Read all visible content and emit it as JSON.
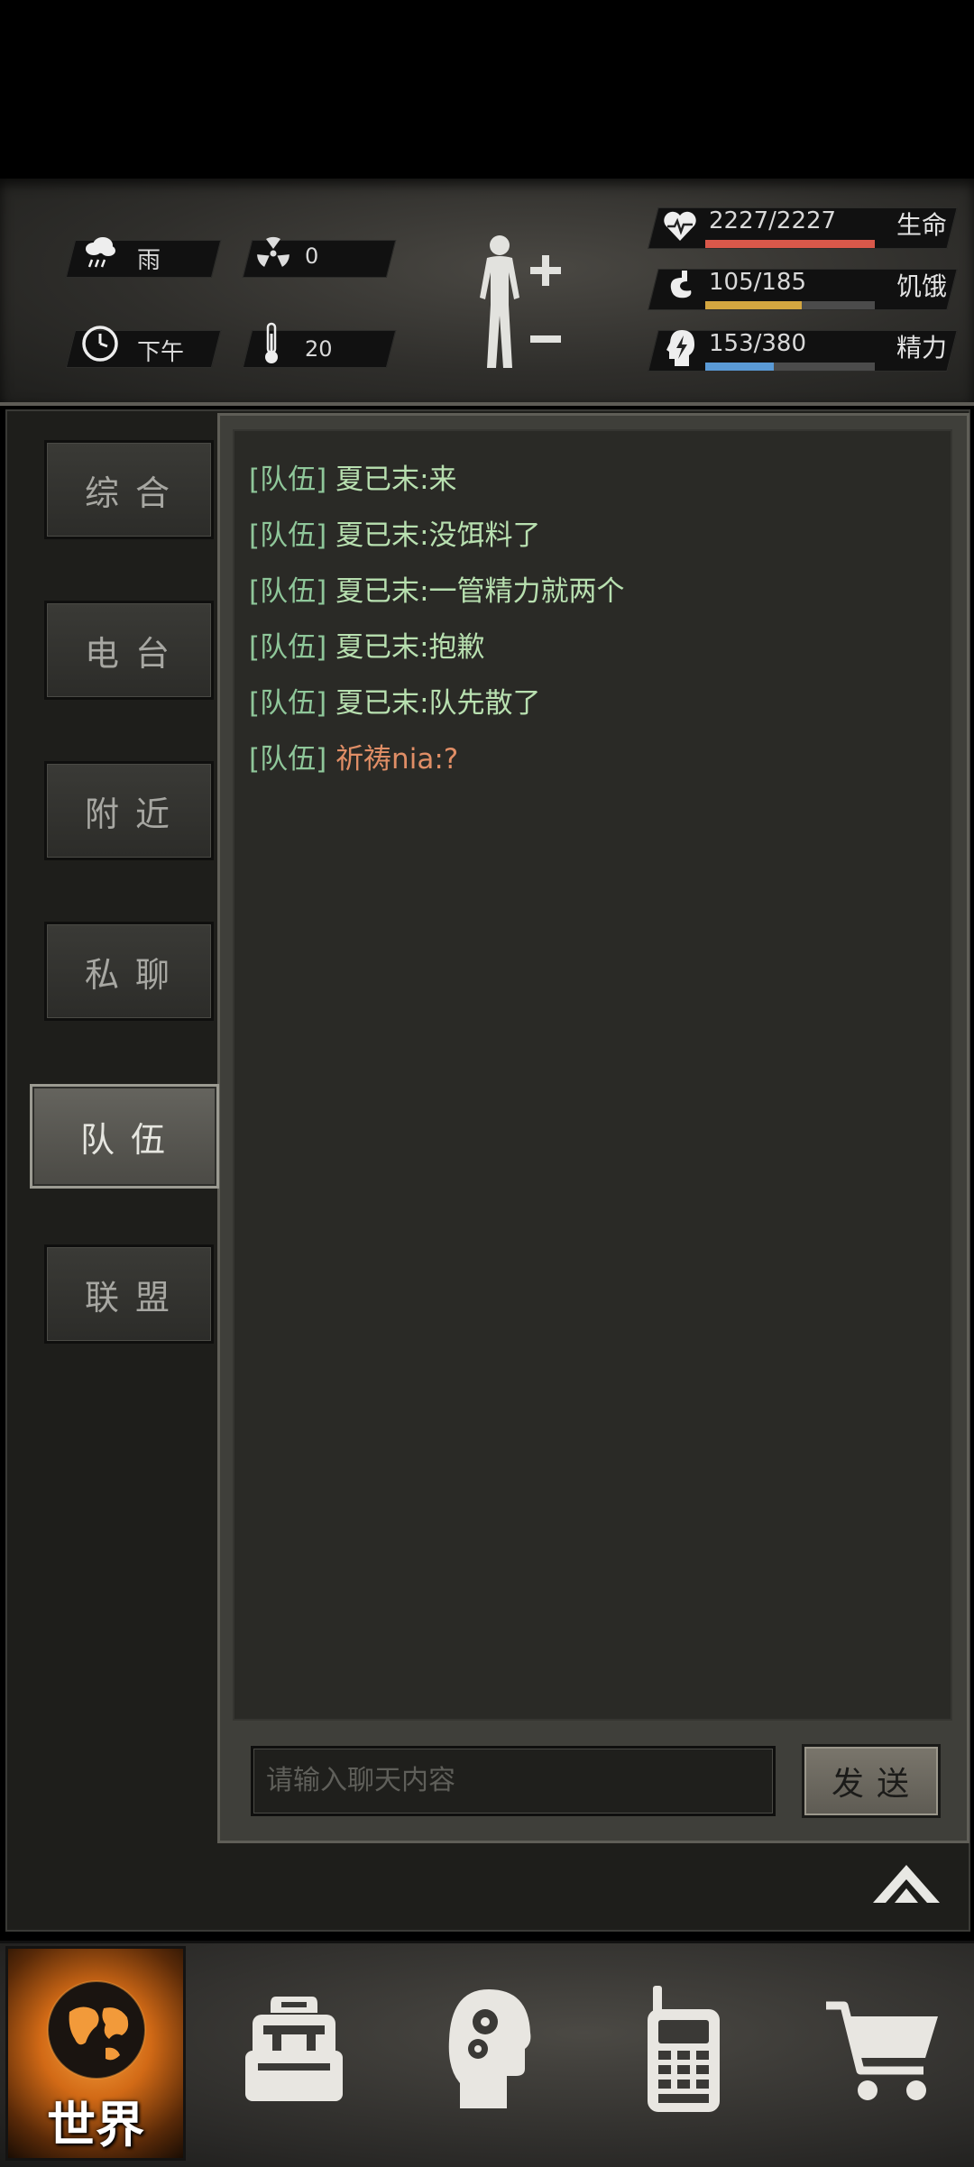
{
  "hud": {
    "weather": {
      "icon": "rain-cloud-icon",
      "label": "雨"
    },
    "radiation": {
      "icon": "radiation-icon",
      "value": "0"
    },
    "time": {
      "icon": "clock-icon",
      "label": "下午"
    },
    "temperature": {
      "icon": "thermometer-icon",
      "value": "20"
    },
    "body_icon": "human-body-icon",
    "stats": [
      {
        "icon": "heart-pulse-icon",
        "value": "2227/2227",
        "label": "生命",
        "fraction": 1.0,
        "color": "#d9584a"
      },
      {
        "icon": "stomach-icon",
        "value": "105/185",
        "label": "饥饿",
        "fraction": 0.5676,
        "color": "#d4a640"
      },
      {
        "icon": "brain-bolt-icon",
        "value": "153/380",
        "label": "精力",
        "fraction": 0.4026,
        "color": "#5a9ad6"
      }
    ]
  },
  "tabs": [
    {
      "label": "综合"
    },
    {
      "label": "电台"
    },
    {
      "label": "附近"
    },
    {
      "label": "私聊"
    },
    {
      "label": "队伍",
      "active": true
    },
    {
      "label": "联盟"
    }
  ],
  "chat": {
    "messages": [
      {
        "channel": "[队伍]",
        "name": "夏已末",
        "text": ":来"
      },
      {
        "channel": "[队伍]",
        "name": "夏已末",
        "text": ":没饵料了"
      },
      {
        "channel": "[队伍]",
        "name": "夏已末",
        "text": ":一管精力就两个"
      },
      {
        "channel": "[队伍]",
        "name": "夏已末",
        "text": ":抱歉"
      },
      {
        "channel": "[队伍]",
        "name": "夏已末",
        "text": ":队先散了"
      },
      {
        "channel": "[队伍]",
        "name": "祈祷nia",
        "text": ":?"
      }
    ],
    "input_placeholder": "请输入聊天内容",
    "send_label": "发送"
  },
  "bottom_nav": {
    "world_label": "世界",
    "items": [
      "globe-icon",
      "backpack-icon",
      "head-gears-icon",
      "walkie-talkie-icon",
      "shopping-cart-icon"
    ]
  }
}
